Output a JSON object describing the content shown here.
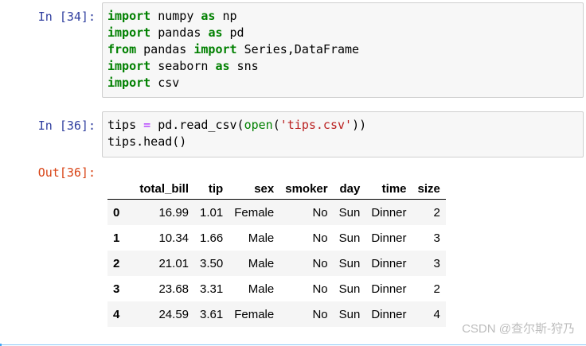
{
  "cells": [
    {
      "prompt": "In  [34]:",
      "lines": [
        [
          {
            "t": "import",
            "c": "kw"
          },
          {
            "t": " numpy ",
            "c": ""
          },
          {
            "t": "as",
            "c": "kw"
          },
          {
            "t": " np",
            "c": ""
          }
        ],
        [
          {
            "t": "import",
            "c": "kw"
          },
          {
            "t": " pandas ",
            "c": ""
          },
          {
            "t": "as",
            "c": "kw"
          },
          {
            "t": " pd",
            "c": ""
          }
        ],
        [
          {
            "t": "from",
            "c": "kw"
          },
          {
            "t": " pandas ",
            "c": ""
          },
          {
            "t": "import",
            "c": "kw"
          },
          {
            "t": " Series,DataFrame",
            "c": ""
          }
        ],
        [
          {
            "t": "import",
            "c": "kw"
          },
          {
            "t": " seaborn ",
            "c": ""
          },
          {
            "t": "as",
            "c": "kw"
          },
          {
            "t": " sns",
            "c": ""
          }
        ],
        [
          {
            "t": "import",
            "c": "kw"
          },
          {
            "t": " csv",
            "c": ""
          }
        ]
      ]
    },
    {
      "prompt": "In  [36]:",
      "lines": [
        [
          {
            "t": "tips ",
            "c": ""
          },
          {
            "t": "=",
            "c": "op"
          },
          {
            "t": " pd.read_csv(",
            "c": ""
          },
          {
            "t": "open",
            "c": "bi"
          },
          {
            "t": "(",
            "c": ""
          },
          {
            "t": "'tips.csv'",
            "c": "st"
          },
          {
            "t": "))",
            "c": ""
          }
        ],
        [
          {
            "t": "tips.head()",
            "c": ""
          }
        ]
      ]
    }
  ],
  "output": {
    "prompt": "Out[36]:",
    "columns": [
      "",
      "total_bill",
      "tip",
      "sex",
      "smoker",
      "day",
      "time",
      "size"
    ],
    "rows": [
      [
        "0",
        "16.99",
        "1.01",
        "Female",
        "No",
        "Sun",
        "Dinner",
        "2"
      ],
      [
        "1",
        "10.34",
        "1.66",
        "Male",
        "No",
        "Sun",
        "Dinner",
        "3"
      ],
      [
        "2",
        "21.01",
        "3.50",
        "Male",
        "No",
        "Sun",
        "Dinner",
        "3"
      ],
      [
        "3",
        "23.68",
        "3.31",
        "Male",
        "No",
        "Sun",
        "Dinner",
        "2"
      ],
      [
        "4",
        "24.59",
        "3.61",
        "Female",
        "No",
        "Sun",
        "Dinner",
        "4"
      ]
    ]
  },
  "watermark": "CSDN @查尔斯-狩乃",
  "colors": {
    "keyword": "#008000",
    "operator": "#aa22ff",
    "string": "#ba2121",
    "in_prompt": "#303f9f",
    "out_prompt": "#d84315",
    "cell_background": "#f7f7f7",
    "selection_accent": "#42a5f5"
  }
}
